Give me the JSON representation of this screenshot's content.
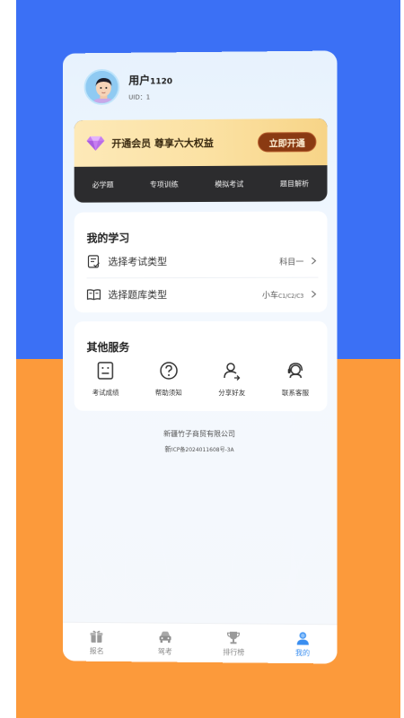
{
  "profile": {
    "name_prefix": "用户",
    "name_number": "1120",
    "uid": "UID：1"
  },
  "vip": {
    "title": "开通会员 尊享六大权益",
    "button": "立即开通",
    "tabs": [
      "必学题",
      "专项训练",
      "模拟考试",
      "题目解析"
    ]
  },
  "study": {
    "title": "我的学习",
    "rows": [
      {
        "icon": "exam-list-icon",
        "label": "选择考试类型",
        "value_main": "科目一",
        "value_small": ""
      },
      {
        "icon": "book-icon",
        "label": "选择题库类型",
        "value_main": "小车",
        "value_small": "C1/C2/C3"
      }
    ]
  },
  "services": {
    "title": "其他服务",
    "items": [
      {
        "icon": "score-icon",
        "label": "考试成绩"
      },
      {
        "icon": "help-icon",
        "label": "帮助须知"
      },
      {
        "icon": "share-icon",
        "label": "分享好友"
      },
      {
        "icon": "customer-service-icon",
        "label": "联系客服"
      }
    ]
  },
  "footer": {
    "company": "新疆竹子商贸有限公司",
    "icp_prefix": "新",
    "icp_code": "ICP备2024011608号-3A"
  },
  "tabbar": {
    "items": [
      {
        "icon": "gift-icon",
        "label": "报名",
        "active": false
      },
      {
        "icon": "car-icon",
        "label": "驾考",
        "active": false
      },
      {
        "icon": "trophy-icon",
        "label": "排行榜",
        "active": false
      },
      {
        "icon": "user-icon",
        "label": "我的",
        "active": true
      }
    ]
  },
  "colors": {
    "background_top": "#3b70f5",
    "background_bottom": "#fc9a3b",
    "vip_button": "#8a3a12",
    "active_tab": "#3a8ef0"
  }
}
